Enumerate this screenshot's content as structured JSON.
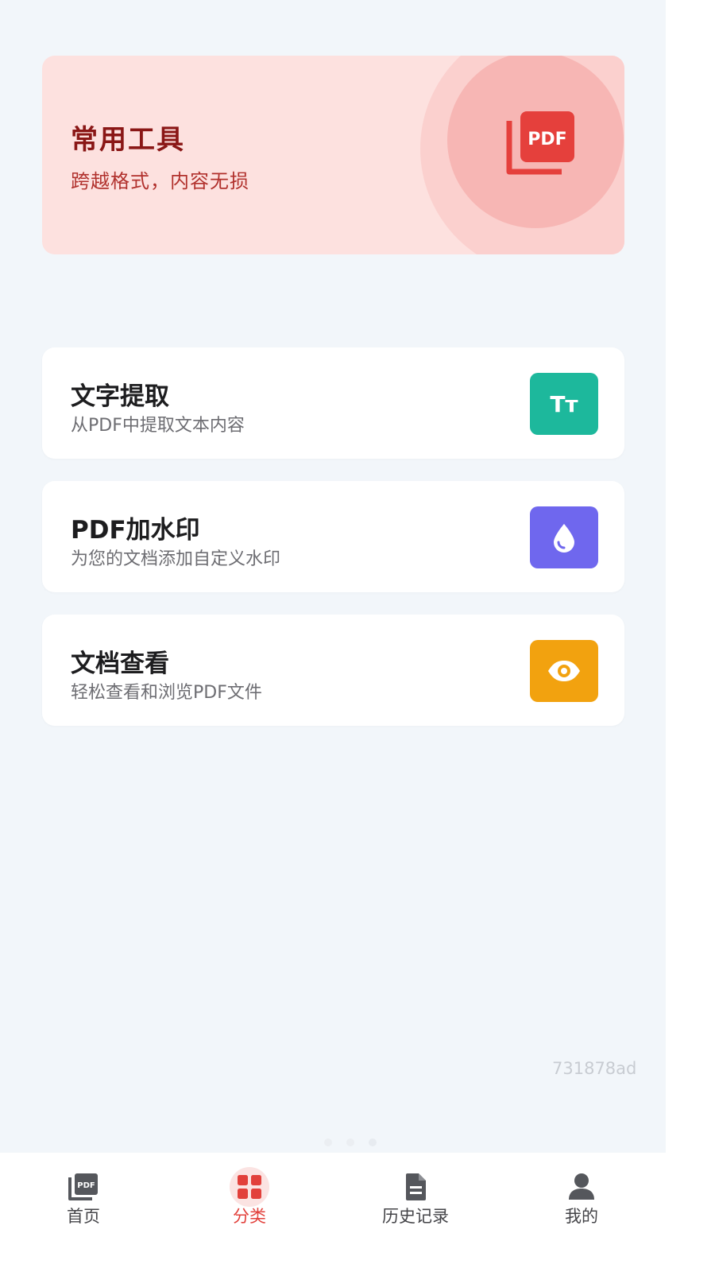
{
  "colors": {
    "page_background": "#f2f6fa",
    "banner_background": "#fde1df",
    "banner_title": "#8a1716",
    "banner_subtitle": "#b1312d",
    "accent_red": "#e2403b",
    "text_extract_icon": "#1db89c",
    "watermark_icon": "#6f67ee",
    "viewer_icon": "#f2a20f"
  },
  "banner": {
    "title": "常用工具",
    "subtitle": "跨越格式，内容无损",
    "icon_text": "PDF",
    "icon": "pdf-file-icon"
  },
  "tools": [
    {
      "title": "文字提取",
      "description": "从PDF中提取文本内容",
      "icon": "text-size-icon",
      "icon_text": "Tт"
    },
    {
      "title": "PDF加水印",
      "description": "为您的文档添加自定义水印",
      "icon": "water-drop-icon"
    },
    {
      "title": "文档查看",
      "description": "轻松查看和浏览PDF文件",
      "icon": "eye-icon"
    }
  ],
  "footer_code": "731878ad",
  "bottom_nav": {
    "active_index": 1,
    "items": [
      {
        "label": "首页",
        "icon": "pdf-home-icon",
        "icon_text": "PDF"
      },
      {
        "label": "分类",
        "icon": "grid-icon"
      },
      {
        "label": "历史记录",
        "icon": "document-icon"
      },
      {
        "label": "我的",
        "icon": "user-icon"
      }
    ]
  }
}
